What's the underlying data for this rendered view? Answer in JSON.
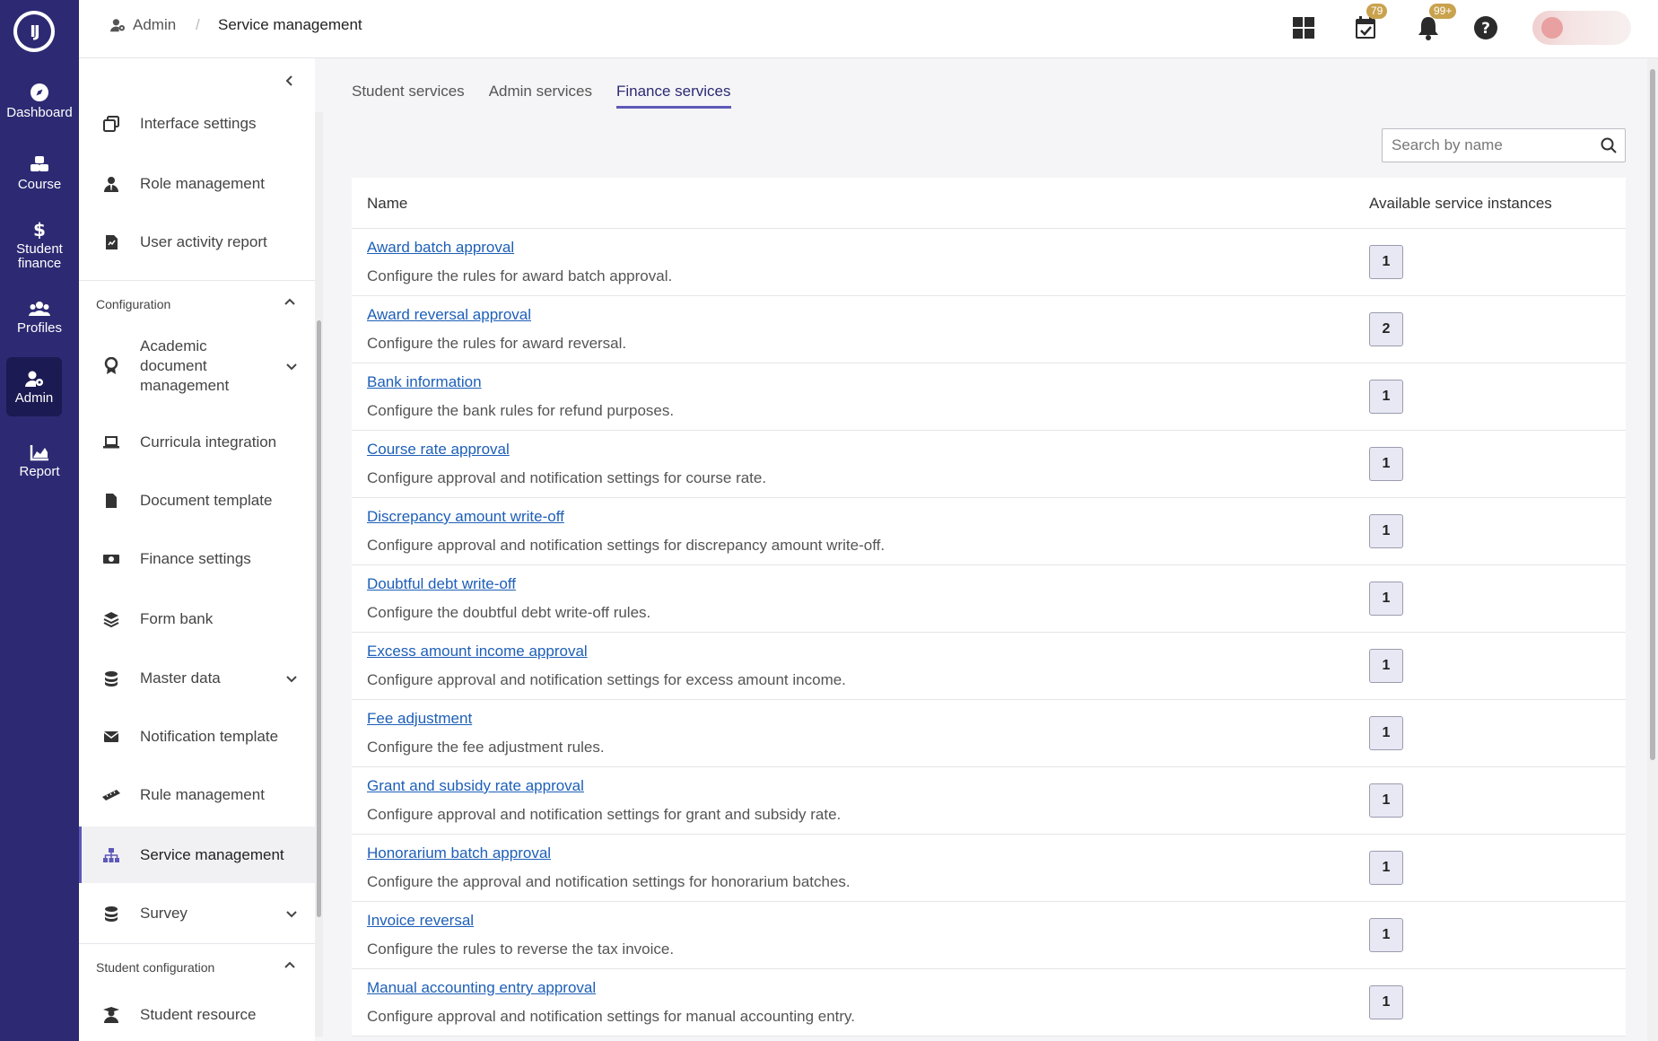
{
  "rail": {
    "logo": "logo",
    "items": [
      {
        "label": "Dashboard",
        "icon": "compass-icon"
      },
      {
        "label": "Course",
        "icon": "cubes-icon"
      },
      {
        "label": "Student finance",
        "icon": "dollar-icon"
      },
      {
        "label": "Profiles",
        "icon": "users-icon"
      },
      {
        "label": "Admin",
        "icon": "user-gear-icon",
        "active": true
      },
      {
        "label": "Report",
        "icon": "chart-area-icon"
      }
    ]
  },
  "topbar": {
    "breadcrumb_root": "Admin",
    "breadcrumb_sep": "/",
    "breadcrumb_current": "Service management",
    "tasks_badge": "79",
    "notifications_badge": "99+"
  },
  "subnav": {
    "items_top": [
      {
        "label": "Interface settings"
      },
      {
        "label": "Role management"
      },
      {
        "label": "User activity report"
      }
    ],
    "section_config": "Configuration",
    "config_items": [
      {
        "label": "Academic document management"
      },
      {
        "label": "Curricula integration"
      },
      {
        "label": "Document template"
      },
      {
        "label": "Finance settings"
      },
      {
        "label": "Form bank"
      },
      {
        "label": "Master data"
      },
      {
        "label": "Notification template"
      },
      {
        "label": "Rule management"
      },
      {
        "label": "Service management"
      },
      {
        "label": "Survey"
      }
    ],
    "section_student": "Student configuration",
    "student_items": [
      {
        "label": "Student resource"
      }
    ]
  },
  "main": {
    "tabs": [
      "Student services",
      "Admin services",
      "Finance services"
    ],
    "active_tab": 2,
    "search_placeholder": "Search by name",
    "columns": {
      "name": "Name",
      "instances": "Available service instances"
    },
    "rows": [
      {
        "name": "Award batch approval",
        "desc": "Configure the rules for award batch approval.",
        "count": "1"
      },
      {
        "name": "Award reversal approval",
        "desc": "Configure the rules for award reversal.",
        "count": "2"
      },
      {
        "name": "Bank information",
        "desc": "Configure the bank rules for refund purposes.",
        "count": "1"
      },
      {
        "name": "Course rate approval",
        "desc": "Configure approval and notification settings for course rate.",
        "count": "1"
      },
      {
        "name": "Discrepancy amount write-off",
        "desc": "Configure approval and notification settings for discrepancy amount write-off.",
        "count": "1"
      },
      {
        "name": "Doubtful debt write-off",
        "desc": "Configure the doubtful debt write-off rules.",
        "count": "1"
      },
      {
        "name": "Excess amount income approval",
        "desc": "Configure approval and notification settings for excess amount income.",
        "count": "1"
      },
      {
        "name": "Fee adjustment",
        "desc": "Configure the fee adjustment rules.",
        "count": "1"
      },
      {
        "name": "Grant and subsidy rate approval",
        "desc": "Configure approval and notification settings for grant and subsidy rate.",
        "count": "1"
      },
      {
        "name": "Honorarium batch approval",
        "desc": "Configure the approval and notification settings for honorarium batches.",
        "count": "1"
      },
      {
        "name": "Invoice reversal",
        "desc": "Configure the rules to reverse the tax invoice.",
        "count": "1"
      },
      {
        "name": "Manual accounting entry approval",
        "desc": "Configure approval and notification settings for manual accounting entry.",
        "count": "1"
      }
    ]
  }
}
